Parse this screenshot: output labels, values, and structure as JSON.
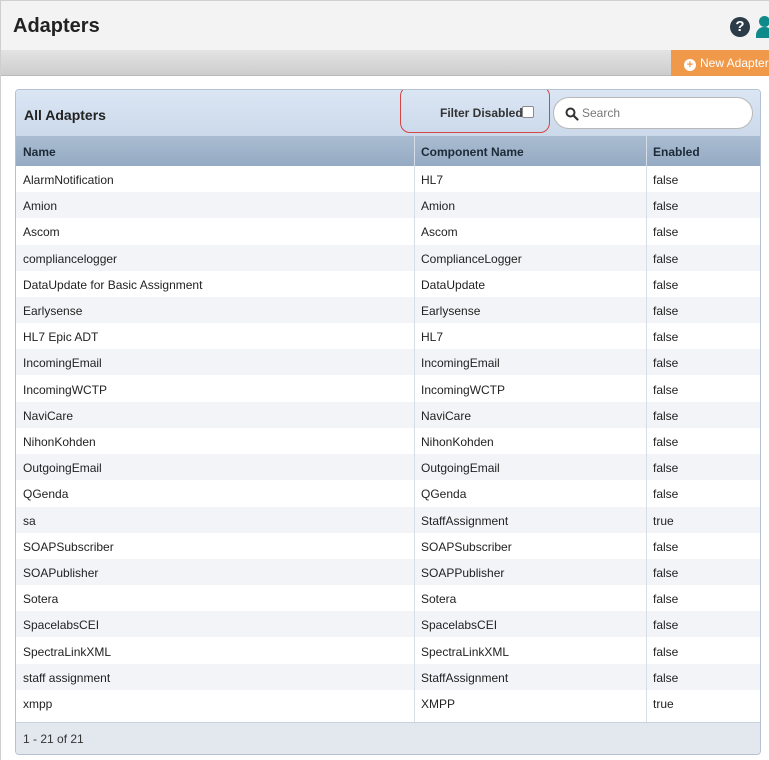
{
  "header": {
    "title": "Adapters"
  },
  "toolbar": {
    "new_adapter_label": "New Adapter"
  },
  "panel": {
    "title": "All Adapters",
    "filter_label": "Filter Disabled:",
    "filter_checked": false,
    "search_placeholder": "Search"
  },
  "table": {
    "columns": [
      "Name",
      "Component Name",
      "Enabled"
    ],
    "rows": [
      [
        "AlarmNotification",
        "HL7",
        "false"
      ],
      [
        "Amion",
        "Amion",
        "false"
      ],
      [
        "Ascom",
        "Ascom",
        "false"
      ],
      [
        "compliancelogger",
        "ComplianceLogger",
        "false"
      ],
      [
        "DataUpdate for Basic Assignment",
        "DataUpdate",
        "false"
      ],
      [
        "Earlysense",
        "Earlysense",
        "false"
      ],
      [
        "HL7 Epic ADT",
        "HL7",
        "false"
      ],
      [
        "IncomingEmail",
        "IncomingEmail",
        "false"
      ],
      [
        "IncomingWCTP",
        "IncomingWCTP",
        "false"
      ],
      [
        "NaviCare",
        "NaviCare",
        "false"
      ],
      [
        "NihonKohden",
        "NihonKohden",
        "false"
      ],
      [
        "OutgoingEmail",
        "OutgoingEmail",
        "false"
      ],
      [
        "QGenda",
        "QGenda",
        "false"
      ],
      [
        "sa",
        "StaffAssignment",
        "true"
      ],
      [
        "SOAPSubscriber",
        "SOAPSubscriber",
        "false"
      ],
      [
        "SOAPublisher",
        "SOAPPublisher",
        "false"
      ],
      [
        "Sotera",
        "Sotera",
        "false"
      ],
      [
        "SpacelabsCEI",
        "SpacelabsCEI",
        "false"
      ],
      [
        "SpectraLinkXML",
        "SpectraLinkXML",
        "false"
      ],
      [
        "staff assignment",
        "StaffAssignment",
        "false"
      ],
      [
        "xmpp",
        "XMPP",
        "true"
      ]
    ]
  },
  "footer": {
    "range": "1 - 21 of 21"
  },
  "icons": {
    "help": "help-icon",
    "user": "user-icon",
    "search": "search-icon",
    "add": "plus-circle-icon"
  },
  "colors": {
    "accent": "#f0994a",
    "header_bar": "#cbd9ea",
    "table_header": "#a9bcd1",
    "highlight": "#d64545"
  }
}
